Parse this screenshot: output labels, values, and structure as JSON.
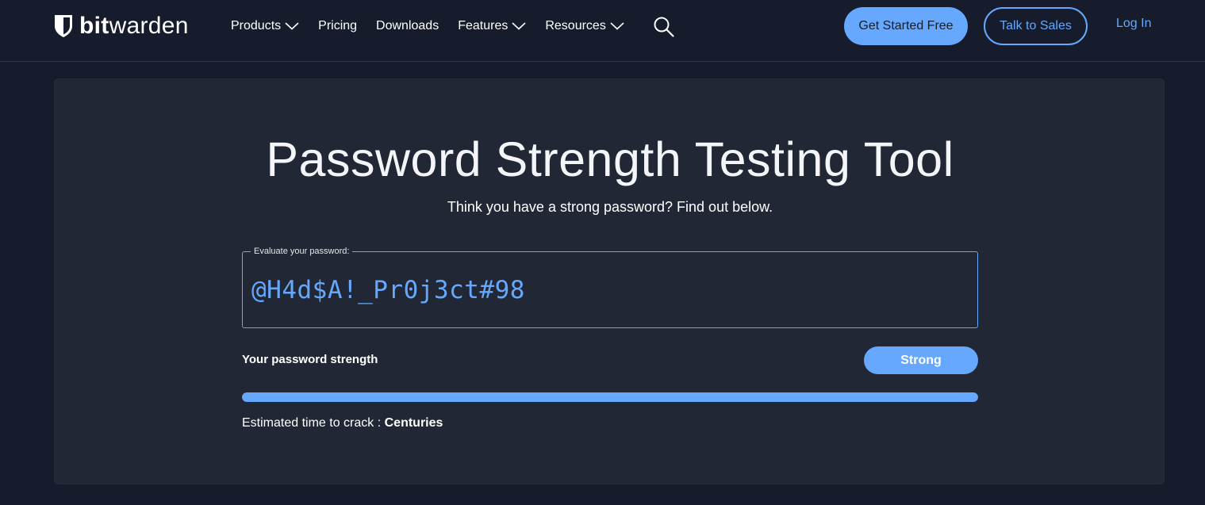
{
  "header": {
    "logo": {
      "bold": "bit",
      "thin": "warden"
    },
    "nav": [
      {
        "label": "Products",
        "has_dropdown": true
      },
      {
        "label": "Pricing",
        "has_dropdown": false
      },
      {
        "label": "Downloads",
        "has_dropdown": false
      },
      {
        "label": "Features",
        "has_dropdown": true
      },
      {
        "label": "Resources",
        "has_dropdown": true
      }
    ],
    "search_icon": "search-icon",
    "cta_primary": "Get Started Free",
    "cta_secondary": "Talk to Sales",
    "login": "Log In"
  },
  "main": {
    "title": "Password Strength Testing Tool",
    "subtitle": "Think you have a strong password? Find out below.",
    "field_label": "Evaluate your password:",
    "password_value": "@H4d$A!_Pr0j3ct#98",
    "strength_label": "Your password strength",
    "strength_value": "Strong",
    "strength_fraction": 1.0,
    "crack_label": "Estimated time to crack :",
    "crack_value": "Centuries"
  },
  "colors": {
    "background": "#161c2b",
    "card": "#212735",
    "accent": "#65a8fd"
  }
}
